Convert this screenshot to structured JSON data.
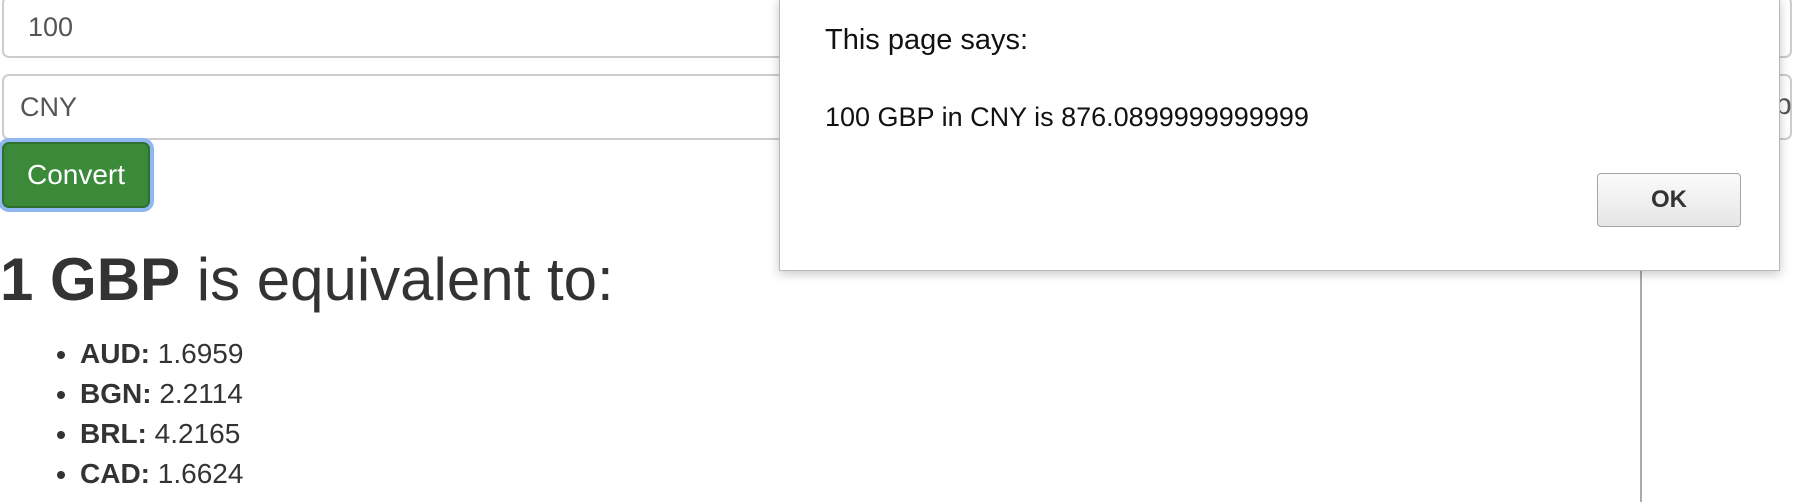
{
  "form": {
    "amount_value": "100",
    "currency_value": "CNY",
    "convert_label": "Convert"
  },
  "rates_section": {
    "heading_strong": "1 GBP",
    "heading_rest": " is equivalent to:",
    "items": [
      {
        "code": "AUD:",
        "value": " 1.6959"
      },
      {
        "code": "BGN:",
        "value": " 2.2114"
      },
      {
        "code": "BRL:",
        "value": " 4.2165"
      },
      {
        "code": "CAD:",
        "value": " 1.6624"
      }
    ]
  },
  "right_edge_text": "p",
  "dialog": {
    "title": "This page says:",
    "message": "100 GBP in CNY is 876.0899999999999",
    "ok_label": "OK"
  }
}
